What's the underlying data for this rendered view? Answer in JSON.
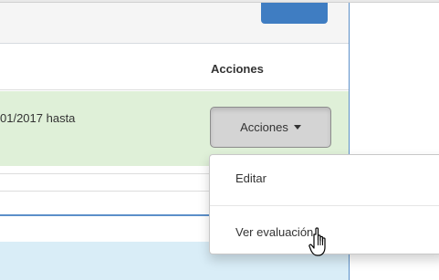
{
  "table": {
    "actions_header": "Acciones",
    "row": {
      "date_text": "01/2017 hasta",
      "actions_button_label": "Acciones"
    }
  },
  "dropdown": {
    "items": [
      {
        "label": "Editar"
      },
      {
        "label": "Ver evaluación"
      }
    ]
  },
  "cursor": {
    "icon": "hand-pointer-icon"
  },
  "colors": {
    "accent": "#3f7dc2",
    "success_row": "#dff0d8",
    "info_row": "#d9edf7"
  }
}
